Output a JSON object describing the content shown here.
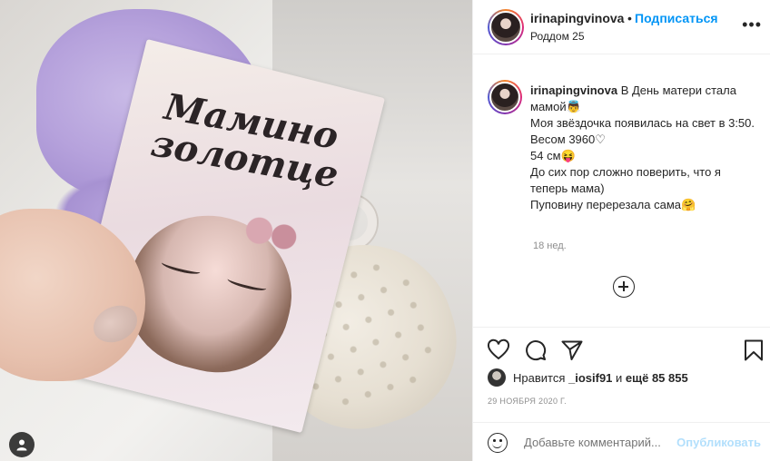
{
  "post": {
    "username": "irinapingvinova",
    "follow_label": "Подписаться",
    "separator": "•",
    "location": "Роддом 25",
    "more_label": "•••"
  },
  "caption": {
    "username": "irinapingvinova",
    "text": " В День матери стала мамой👼\nМоя звёздочка появилась на свет в 3:50.\nВесом 3960♡\n54 см😝\nДо сих пор сложно поверить, что я теперь мама)\nПуповину перерезала сама🤗",
    "time_ago": "18 нед."
  },
  "photo": {
    "card_text": "Мамино золотце"
  },
  "likes": {
    "prefix": "Нравится ",
    "user": "_iosif91",
    "middle": " и ",
    "others": "ещё 85 855"
  },
  "date": "29 НОЯБРЯ 2020 Г.",
  "comment": {
    "placeholder": "Добавьте комментарий...",
    "publish_label": "Опубликовать"
  },
  "icons": {
    "like": "heart-icon",
    "comment": "comment-icon",
    "share": "paper-plane-icon",
    "save": "bookmark-icon",
    "emoji": "emoji-icon",
    "load_more": "plus-circle-icon",
    "user_tag": "user-tag-icon"
  }
}
